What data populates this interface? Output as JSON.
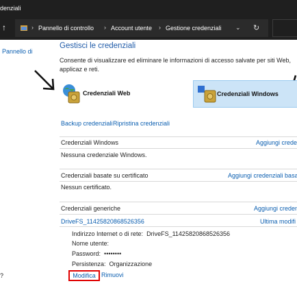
{
  "window": {
    "title": "denziali"
  },
  "address": {
    "crumbs": [
      "Pannello di controllo",
      "Account utente",
      "Gestione credenziali"
    ]
  },
  "sidebar": {
    "home_link": "Pannello di",
    "bottom_text": "?"
  },
  "main": {
    "title": "Gestisci le credenziali",
    "description": "Consente di visualizzare ed eliminare le informazioni di accesso salvate per siti Web, applicaz e reti.",
    "categories": {
      "web": "Credenziali Web",
      "windows": "Credenziali Windows"
    },
    "links": {
      "backup": "Backup credenziali",
      "restore": "Ripristina credenziali"
    },
    "sections": {
      "windows": {
        "title": "Credenziali Windows",
        "action": "Aggiungi creden",
        "empty": "Nessuna credenziale Windows."
      },
      "certificate": {
        "title": "Credenziali basate su certificato",
        "action": "Aggiungi credenziali basate",
        "empty": "Nessun certificato."
      },
      "generic": {
        "title": "Credenziali generiche",
        "action": "Aggiungi creden"
      }
    },
    "credential": {
      "name": "DriveFS_11425820868526356",
      "modified_label": "Ultima modifi",
      "address_label": "Indirizzo Internet o di rete:",
      "address_value": "DriveFS_11425820868526356",
      "username_label": "Nome utente:",
      "password_label": "Password:",
      "password_value": "••••••••",
      "persistence_label": "Persistenza:",
      "persistence_value": "Organizzazione",
      "edit": "Modifica",
      "remove": "Rimuovi"
    }
  },
  "colors": {
    "link": "#0a5eb0",
    "title": "#1e5aa8",
    "selected_bg": "#cce4f7",
    "highlight": "#e00000",
    "titlebar": "#1f1f1f"
  }
}
